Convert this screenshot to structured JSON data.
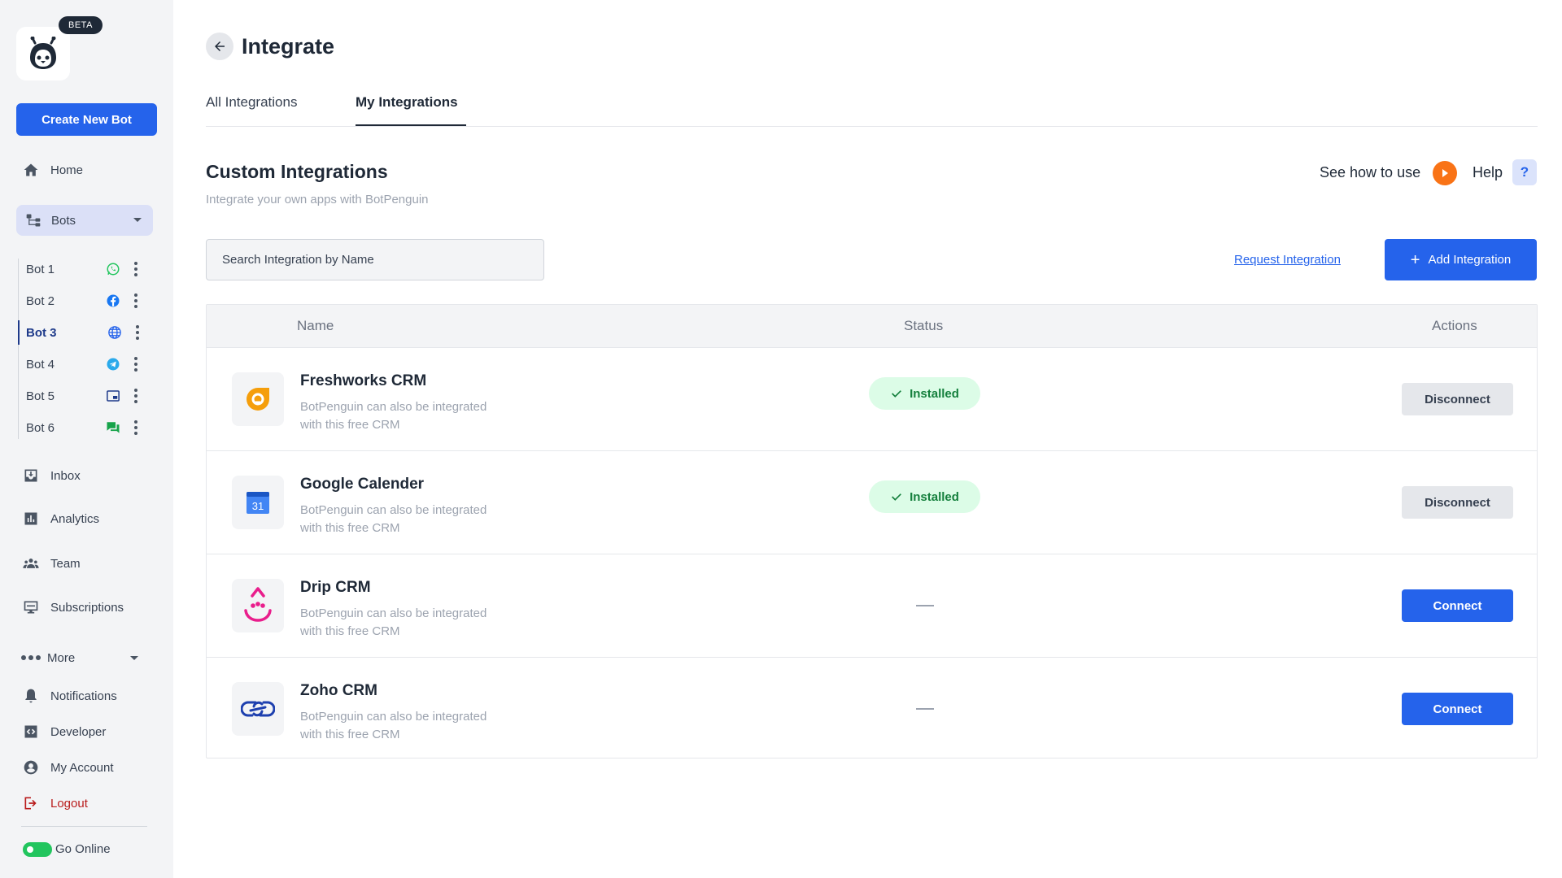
{
  "sidebar": {
    "badge": "BETA",
    "create_button": "Create New Bot",
    "home": "Home",
    "bots": "Bots",
    "bot_list": [
      {
        "name": "Bot 1",
        "channel_icon": "whatsapp-icon"
      },
      {
        "name": "Bot 2",
        "channel_icon": "facebook-icon"
      },
      {
        "name": "Bot 3",
        "channel_icon": "globe-icon"
      },
      {
        "name": "Bot 4",
        "channel_icon": "telegram-icon"
      },
      {
        "name": "Bot 5",
        "channel_icon": "widget-icon"
      },
      {
        "name": "Bot 6",
        "channel_icon": "chat-icon"
      }
    ],
    "active_bot": "Bot 3",
    "inbox": "Inbox",
    "analytics": "Analytics",
    "team": "Team",
    "subscriptions": "Subscriptions",
    "more": "More",
    "notifications": "Notifications",
    "developer": "Developer",
    "my_account": "My Account",
    "logout": "Logout",
    "go_online": "Go Online"
  },
  "header": {
    "title": "Integrate",
    "tabs": [
      {
        "label": "All Integrations"
      },
      {
        "label": "My Integrations"
      }
    ],
    "active_tab": "My Integrations"
  },
  "section": {
    "title": "Custom Integrations",
    "subtitle": "Integrate your own apps with BotPenguin",
    "see_how": "See how to use",
    "help": "Help",
    "help_symbol": "?"
  },
  "toolbar": {
    "search_placeholder": "Search Integration by Name",
    "request_link": "Request Integration",
    "add_button": "Add Integration",
    "add_symbol": "+"
  },
  "table": {
    "headers": {
      "name": "Name",
      "status": "Status",
      "actions": "Actions"
    },
    "rows": [
      {
        "name": "Freshworks CRM",
        "description": "BotPenguin can also be integrated with this free CRM",
        "status": "Installed",
        "action": "Disconnect",
        "icon": "freshworks-icon"
      },
      {
        "name": "Google Calender",
        "description": "BotPenguin can also be integrated with this free CRM",
        "status": "Installed",
        "action": "Disconnect",
        "icon": "google-calendar-icon",
        "icon_text": "31"
      },
      {
        "name": "Drip CRM",
        "description": "BotPenguin can also be integrated with this free CRM",
        "status": "",
        "action": "Connect",
        "icon": "drip-icon"
      },
      {
        "name": "Zoho CRM",
        "description": "BotPenguin can also be integrated with this free CRM",
        "status": "",
        "action": "Connect",
        "icon": "zoho-icon"
      }
    ]
  },
  "colors": {
    "primary": "#2563eb",
    "installed_bg": "#dcfce7",
    "installed_text": "#15803d",
    "logout": "#b91c1c",
    "online": "#22c55e",
    "play": "#f97316"
  }
}
